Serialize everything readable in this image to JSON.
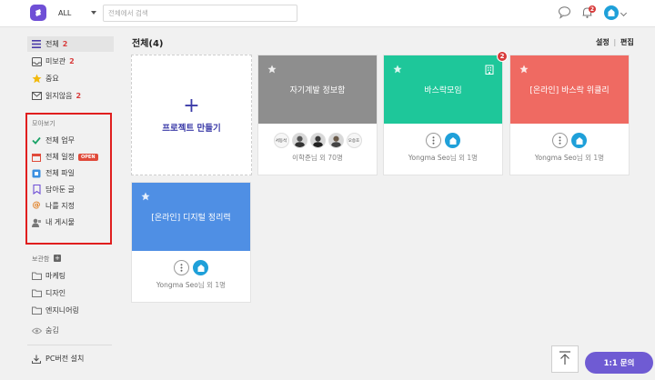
{
  "header": {
    "scope_value": "ALL",
    "search_placeholder": "전체에서 검색",
    "notification_count": "2"
  },
  "sidebar": {
    "items": [
      {
        "label": "전체",
        "count": "2"
      },
      {
        "label": "미보관",
        "count": "2"
      },
      {
        "label": "중요",
        "count": ""
      },
      {
        "label": "읽지않음",
        "count": "2"
      }
    ],
    "browse_label": "모아보기",
    "browse_items": [
      {
        "label": "전체 업무"
      },
      {
        "label": "전체 일정",
        "badge": "OPEN"
      },
      {
        "label": "전체 파일"
      },
      {
        "label": "담아둔 글"
      },
      {
        "label": "나를 지정"
      },
      {
        "label": "내 게시물"
      }
    ],
    "storage_label": "보관함",
    "folders": [
      {
        "label": "마케팅"
      },
      {
        "label": "디자인"
      },
      {
        "label": "엔지니어링"
      }
    ],
    "hidden_label": "숨김",
    "install_label": "PC버전 설치"
  },
  "main": {
    "title": "전체(4)",
    "settings_label": "설정",
    "separator": "|",
    "edit_label": "편집",
    "create_label": "프로젝트 만들기",
    "create_plus": "+",
    "cards": [
      {
        "title": "자기계발 정보함",
        "color": "#8e8e8e",
        "owner": "이학준",
        "suffix": "님 외 70명",
        "members": [
          "서동석",
          "",
          "",
          "",
          "오승호"
        ]
      },
      {
        "title": "바스락모임",
        "color": "#1ec79a",
        "owner": "Yongma Seo",
        "suffix": "님 외 1명",
        "badge": "2"
      },
      {
        "title": "[온라인] 바스락 위클리",
        "color": "#ef6a62",
        "owner": "Yongma Seo",
        "suffix": "님 외 1명"
      },
      {
        "title": "[온라인] 디지털 정리력",
        "color": "#4f8fe4",
        "owner": "Yongma Seo",
        "suffix": "님 외 1명"
      }
    ]
  },
  "footer": {
    "inquiry_label": "1:1 문의"
  },
  "colors": {
    "accent": "#6f4fd6",
    "badge": "#d83b3b",
    "highlight_box": "#e01e1e"
  }
}
